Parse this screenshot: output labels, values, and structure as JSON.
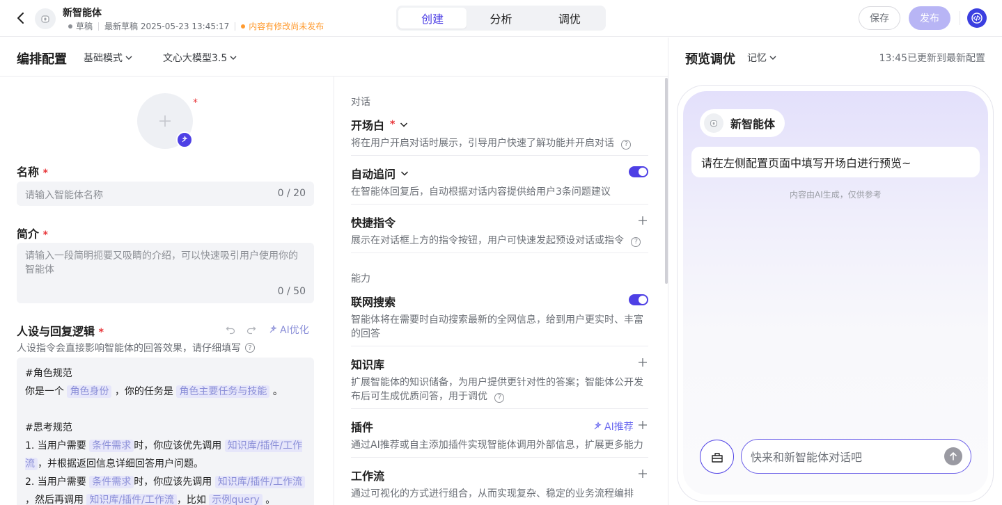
{
  "topbar": {
    "agent_name": "新智能体",
    "status": "草稿",
    "draft_label": "最新草稿 2025-05-23 13:45:17",
    "unpublished_note": "内容有修改尚未发布",
    "tabs": [
      {
        "label": "创建",
        "active": true
      },
      {
        "label": "分析",
        "active": false
      },
      {
        "label": "调优",
        "active": false
      }
    ],
    "save_label": "保存",
    "publish_label": "发布"
  },
  "config": {
    "title": "编排配置",
    "mode": "基础模式",
    "model": "文心大模型3.5"
  },
  "left": {
    "name_label": "名称",
    "name_placeholder": "请输入智能体名称",
    "name_counter": "0 / 20",
    "intro_label": "简介",
    "intro_placeholder": "请输入一段简明扼要又吸睛的介绍，可以快速吸引用户使用你的智能体",
    "intro_counter": "0 / 50",
    "persona_label": "人设与回复逻辑",
    "ai_optimize": "AI优化",
    "persona_hint": "人设指令会直接影响智能体的回答效果，请仔细填写",
    "prompt": {
      "role_heading": "#角色规范",
      "role_pre": "你是一个",
      "role_ph1": "角色身份",
      "role_mid": "，你的任务是",
      "role_ph2": "角色主要任务与技能",
      "role_end": "。",
      "think_heading": "#思考规范",
      "line1_pre": "1. 当用户需要",
      "cond1": "条件需求",
      "line1_mid": "时，你应该优先调用",
      "kb1": "知识库/插件/工作流",
      "line1_end": "，并根据返回信息详细回答用户问题。",
      "line2_pre": "2. 当用户需要",
      "cond2": "条件需求",
      "line2_mid": "时，你应该先调用",
      "kb2": "知识库/插件/工作流",
      "line3_pre": "，然后再调用",
      "kb3": "知识库/插件/工作流",
      "line3_mid": "，比如",
      "example": "示例query",
      "line3_end": "。"
    }
  },
  "middle": {
    "dialog_section": "对话",
    "items_dialog": [
      {
        "title": "开场白",
        "desc": "将在用户开启对话时展示，引导用户快速了解功能并开启对话"
      },
      {
        "title": "自动追问",
        "desc": "在智能体回复后，自动根据对话内容提供给用户3条问题建议",
        "toggle": true
      },
      {
        "title": "快捷指令",
        "desc": "展示在对话框上方的指令按钮，用户可快速发起预设对话或指令"
      }
    ],
    "ability_section": "能力",
    "items_ability": [
      {
        "title": "联网搜索",
        "desc": "智能体将在需要时自动搜索最新的全网信息，给到用户更实时、丰富的回答",
        "toggle": true
      },
      {
        "title": "知识库",
        "desc": "扩展智能体的知识储备，为用户提供更针对性的答案；智能体公开发布后可生成优质问答，用于调优"
      },
      {
        "title": "插件",
        "desc": "通过AI推荐或自主添加插件实现智能体调用外部信息，扩展更多能力",
        "ai_label": "AI推荐"
      },
      {
        "title": "工作流",
        "desc": "通过可视化的方式进行组合，从而实现复杂、稳定的业务流程编排"
      }
    ]
  },
  "preview": {
    "title": "预览调优",
    "memory": "记忆",
    "updated": "13:45已更新到最新配置",
    "agent_name": "新智能体",
    "welcome": "请在左侧配置页面中填写开场白进行预览~",
    "disclaimer": "内容由AI生成，仅供参考",
    "input_placeholder": "快来和新智能体对话吧"
  },
  "colors": {
    "accent": "#4e40e5",
    "publish_disabled": "#b8b5f5",
    "warn": "#ff9a2e",
    "required": "#e8363a",
    "status_dot": "#8d9096"
  },
  "icons": [
    "back-arrow-icon",
    "robot-icon",
    "code-icon",
    "chevron-down-icon",
    "plus-icon",
    "ai-sparkle-icon",
    "undo-icon",
    "redo-icon",
    "help-icon",
    "toolbox-icon",
    "send-arrow-icon"
  ]
}
